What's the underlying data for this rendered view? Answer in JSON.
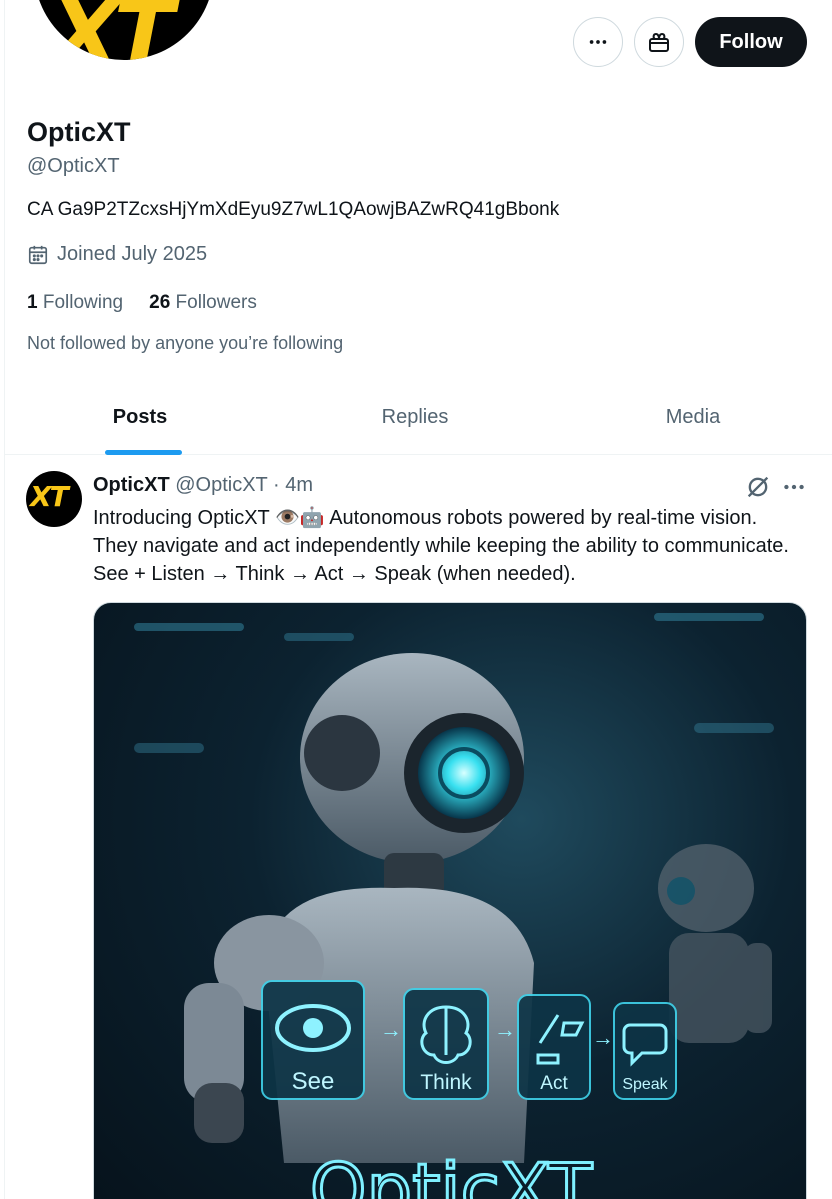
{
  "profile": {
    "display_name": "OpticXT",
    "handle": "@OpticXT",
    "avatar_text": "XT",
    "bio": "CA Ga9P2TZcxsHjYmXdEyu9Z7wL1QAowjBAZwRQ41gBbonk",
    "joined": "Joined July 2025",
    "following_count": "1",
    "following_label": "Following",
    "followers_count": "26",
    "followers_label": "Followers",
    "not_followed": "Not followed by anyone you’re following"
  },
  "actions": {
    "follow_label": "Follow"
  },
  "tabs": [
    {
      "label": "Posts",
      "active": true
    },
    {
      "label": "Replies",
      "active": false
    },
    {
      "label": "Media",
      "active": false
    }
  ],
  "post": {
    "author": "OpticXT",
    "handle": "@OpticXT",
    "separator": "·",
    "time": "4m",
    "text": "Introducing OpticXT 👁️🤖 Autonomous robots powered by real-time vision. They navigate and act independently while keeping the ability to communicate. See + Listen → Think → Act → Speak (when needed).",
    "image": {
      "steps": [
        "See",
        "Think",
        "Act",
        "Speak"
      ],
      "brand_text": "OpticXT"
    }
  },
  "colors": {
    "brand_yellow": "#f8c618",
    "accent_blue": "#1d9bf0",
    "text_primary": "#0f1419",
    "text_secondary": "#536471"
  }
}
